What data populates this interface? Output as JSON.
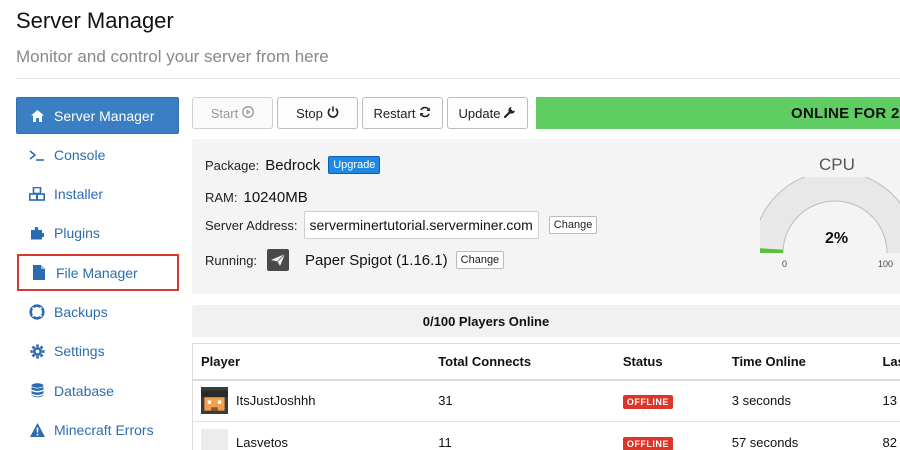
{
  "header": {
    "title": "Server Manager",
    "subtitle": "Monitor and control your server from here"
  },
  "sidebar": {
    "items": [
      {
        "label": "Server Manager",
        "icon": "home-icon",
        "active": true
      },
      {
        "label": "Console",
        "icon": "terminal-icon"
      },
      {
        "label": "Installer",
        "icon": "cubes-icon"
      },
      {
        "label": "Plugins",
        "icon": "puzzle-icon"
      },
      {
        "label": "File Manager",
        "icon": "file-icon",
        "highlighted": true
      },
      {
        "label": "Backups",
        "icon": "lifebuoy-icon"
      },
      {
        "label": "Settings",
        "icon": "gear-icon"
      },
      {
        "label": "Database",
        "icon": "database-icon"
      },
      {
        "label": "Minecraft Errors",
        "icon": "warning-icon"
      }
    ]
  },
  "toolbar": {
    "start_label": "Start",
    "stop_label": "Stop",
    "restart_label": "Restart",
    "update_label": "Update"
  },
  "status": {
    "banner_text": "ONLINE FOR 2",
    "color": "#5fcd62"
  },
  "info": {
    "package_label": "Package:",
    "package_value": "Bedrock",
    "upgrade_label": "Upgrade",
    "ram_label": "RAM:",
    "ram_value": "10240MB",
    "address_label": "Server Address:",
    "address_value": "serverminertutorial.serverminer.com",
    "change_label": "Change",
    "running_label": "Running:",
    "running_value": "Paper Spigot (1.16.1)",
    "change2_label": "Change"
  },
  "cpu": {
    "title": "CPU",
    "value_text": "2%",
    "value": 2,
    "min": "0",
    "max": "100"
  },
  "players": {
    "online_text": "0/100 Players Online",
    "columns": [
      "Player",
      "Total Connects",
      "Status",
      "Time Online",
      "Las"
    ],
    "rows": [
      {
        "name": "ItsJustJoshhh",
        "connects": "31",
        "status": "OFFLINE",
        "time": "3 seconds",
        "last": "13"
      },
      {
        "name": "Lasvetos",
        "connects": "11",
        "status": "OFFLINE",
        "time": "57 seconds",
        "last": "82"
      }
    ]
  },
  "colors": {
    "accent": "#3a7ec3",
    "offline": "#d9372b",
    "highlight_border": "#d9372b"
  }
}
